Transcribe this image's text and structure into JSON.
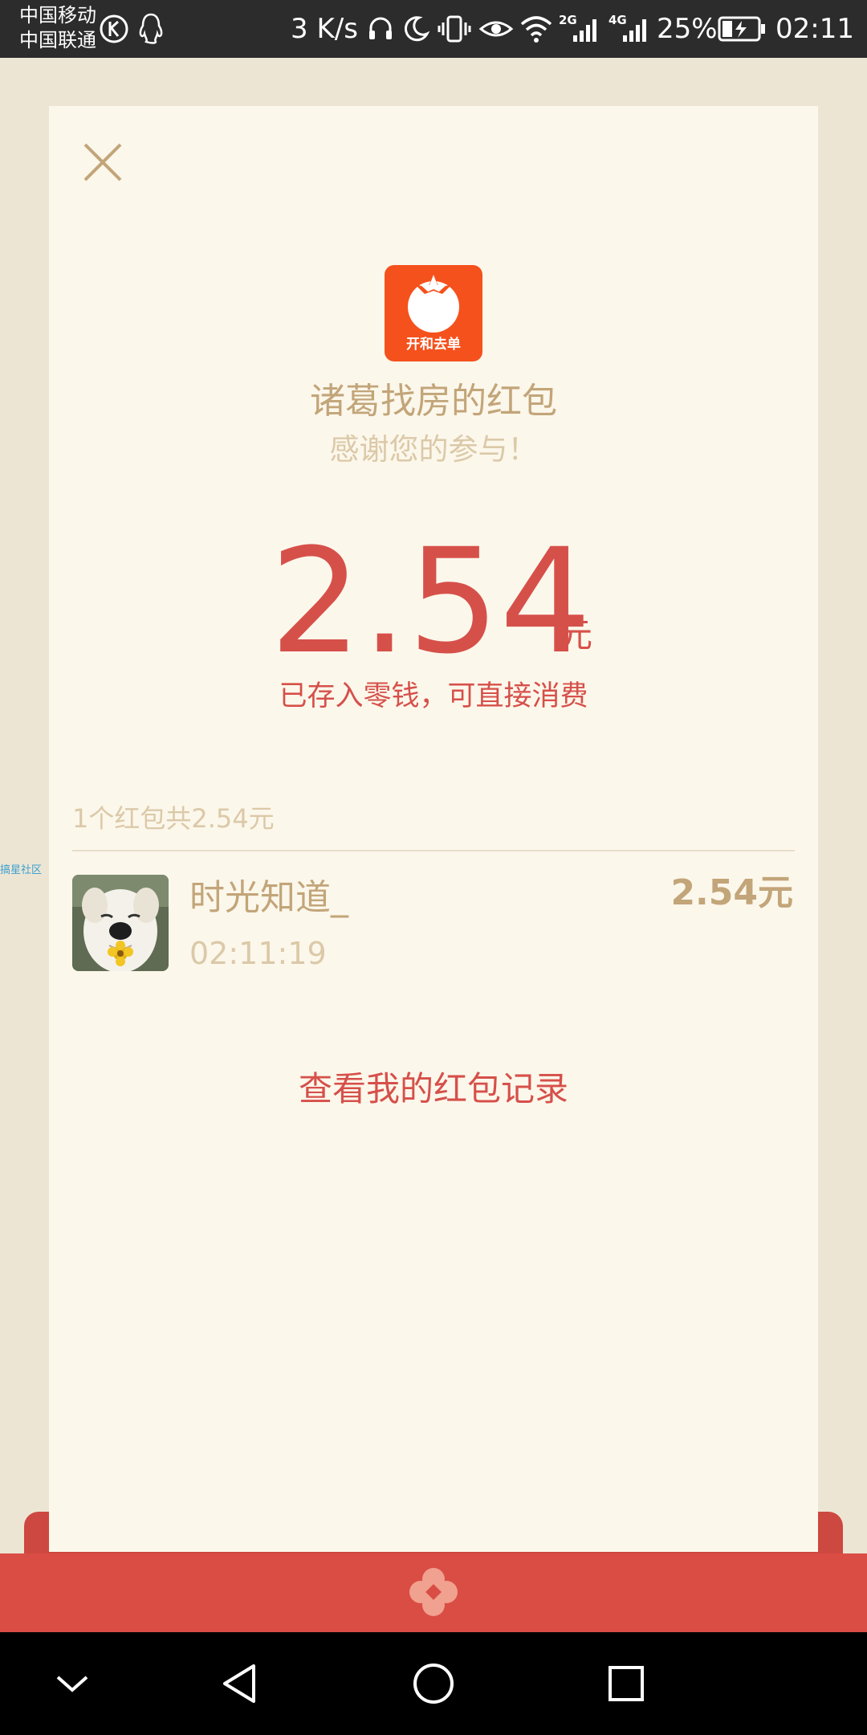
{
  "status_bar": {
    "carrier_1": "中国移动",
    "carrier_2": "中国联通",
    "speed": "3 K/s",
    "net_label_1": "2G",
    "net_label_2": "4G",
    "battery": "25%",
    "time": "02:11"
  },
  "envelope": {
    "logo_text": "开和去单",
    "sender_title": "诸葛找房的红包",
    "thanks": "感谢您的参与！",
    "amount": "2.54",
    "currency": "元",
    "stored_note": "已存入零钱，可直接消费",
    "summary": "1个红包共2.54元",
    "side_label": "搞星社区",
    "receiver": {
      "name": "时光知道_",
      "time": "02:11:19",
      "amount": "2.54元"
    },
    "records_link": "查看我的红包记录"
  },
  "colors": {
    "accent_red": "#d6504a",
    "gold_text": "#c2a579",
    "light_gold_text": "#dbc9a8",
    "card_bg": "#fcf7eb",
    "page_bg": "#ede5d4",
    "logo_bg": "#f5511c"
  },
  "icons": {
    "close": "close-icon",
    "signal": "signal-icon",
    "wifi": "wifi-icon",
    "battery": "battery-icon",
    "back": "back-icon",
    "home": "home-icon",
    "recents": "recents-icon",
    "hide": "chevron-down-icon"
  }
}
